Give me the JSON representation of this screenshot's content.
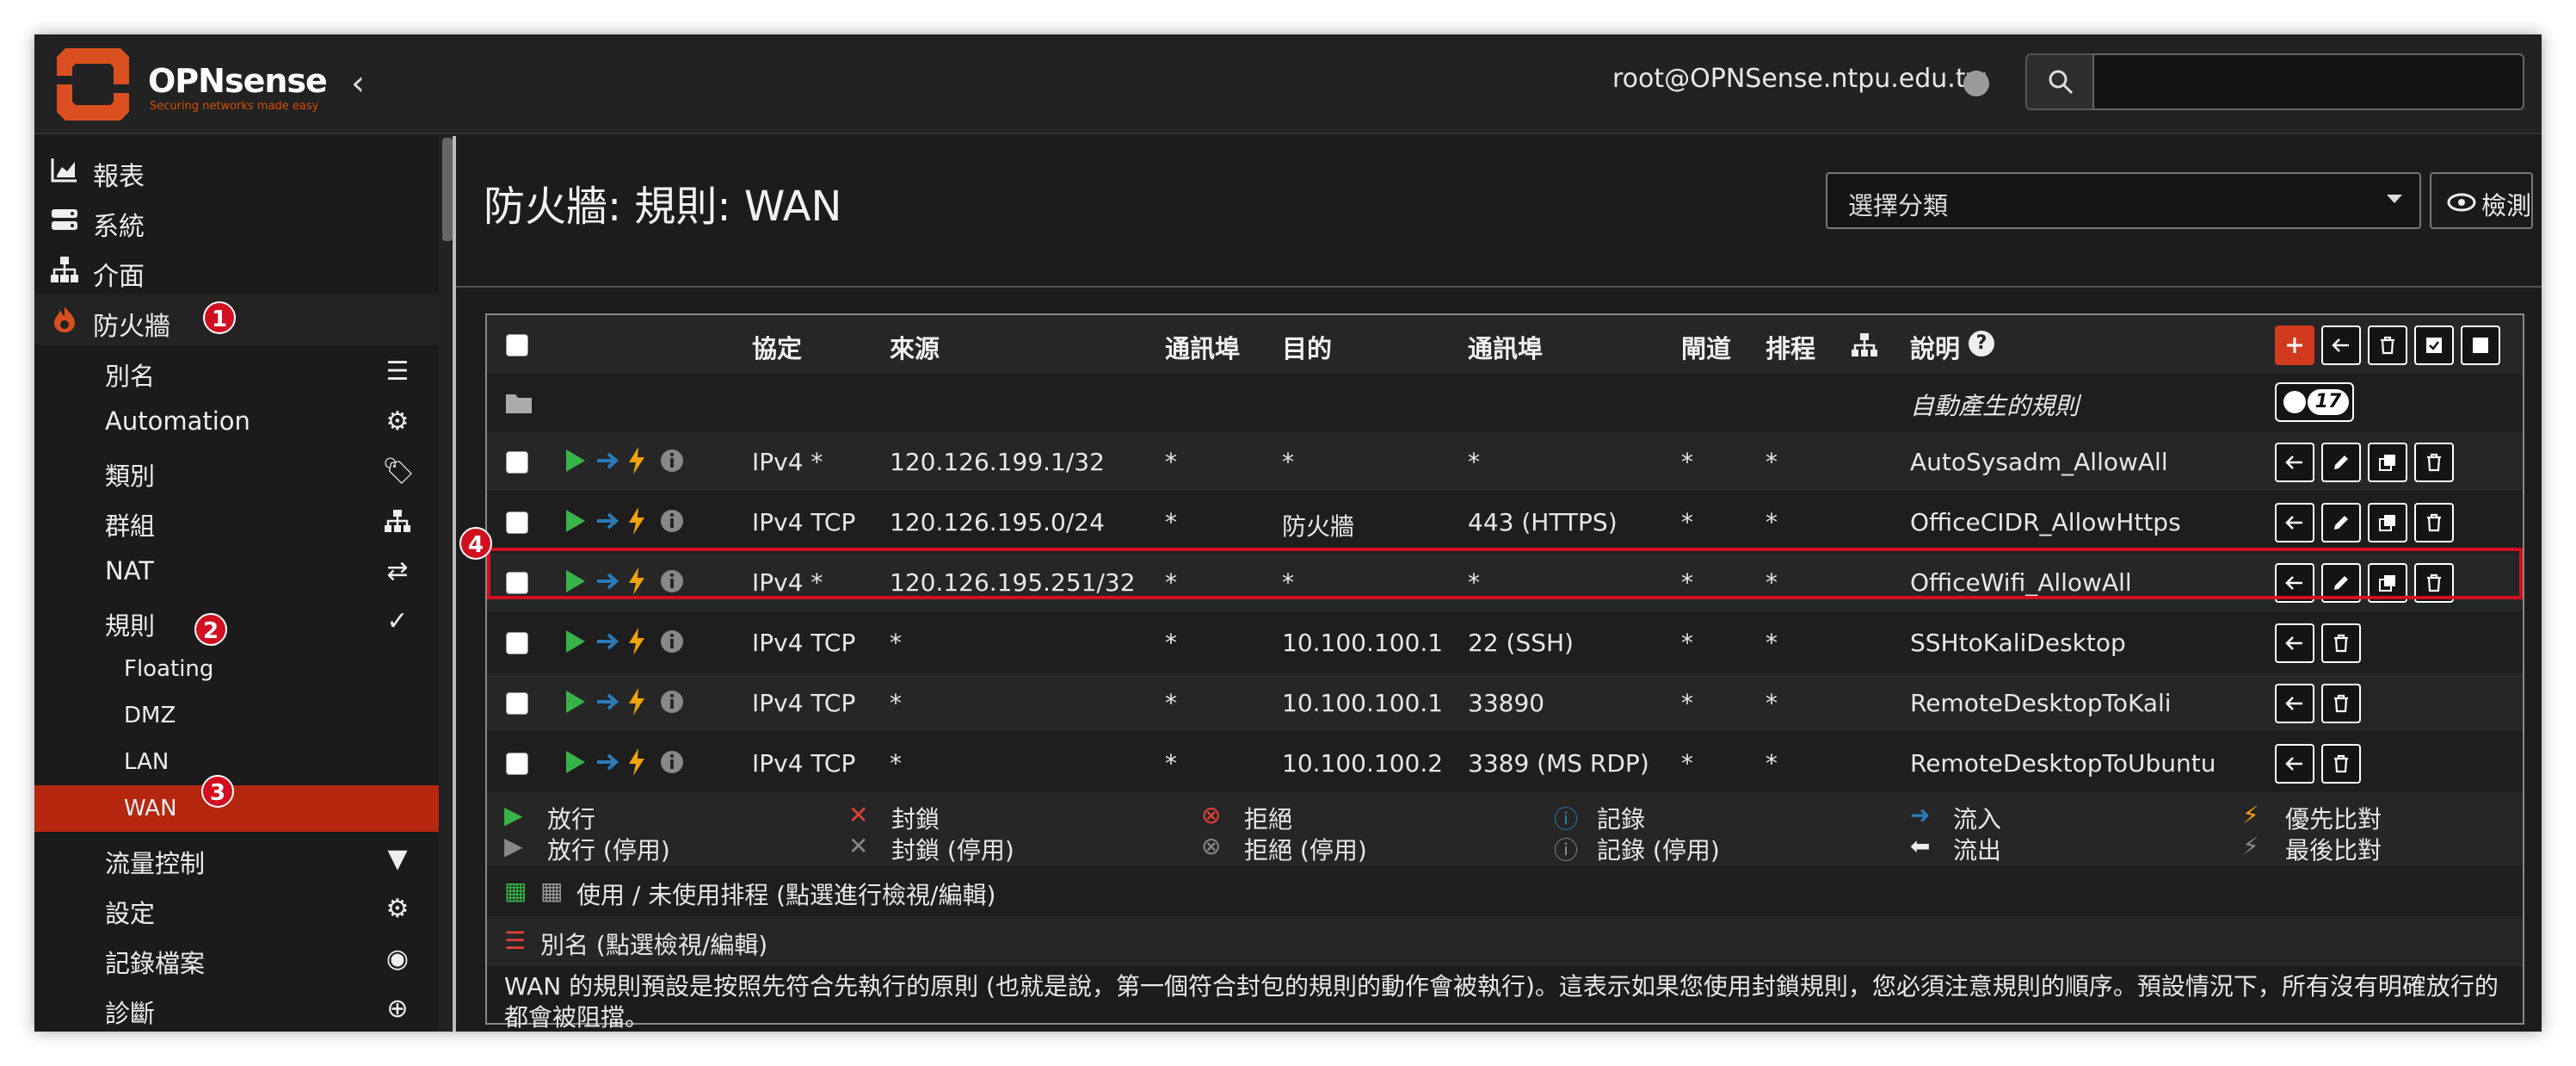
{
  "header": {
    "brand": "OPNsense",
    "tagline": "Securing networks made easy",
    "user": "root@OPNSense.ntpu.edu.tw",
    "search_value": ""
  },
  "sidebar": {
    "top_items": [
      "報表",
      "系統",
      "介面",
      "防火牆"
    ],
    "firewall_items": [
      "別名",
      "Automation",
      "類別",
      "群組",
      "NAT",
      "規則"
    ],
    "rule_items": [
      "Floating",
      "DMZ",
      "LAN",
      "WAN"
    ],
    "bottom_items": [
      "流量控制",
      "設定",
      "記錄檔案",
      "診斷"
    ]
  },
  "annotations": [
    "1",
    "2",
    "3",
    "4"
  ],
  "page": {
    "title": "防火牆: 規則: WAN",
    "category_placeholder": "選擇分類",
    "inspect_label": "檢測"
  },
  "table": {
    "headers": [
      "協定",
      "來源",
      "通訊埠",
      "目的",
      "通訊埠",
      "閘道",
      "排程",
      "說明"
    ],
    "auto_rules_label": "自動產生的規則",
    "auto_rules_count": "17",
    "rows": [
      {
        "proto": "IPv4 *",
        "src": "120.126.199.1/32",
        "sport": "*",
        "dst": "*",
        "dport": "*",
        "gw": "*",
        "sched": "*",
        "desc": "AutoSysadm_AllowAll",
        "edit": true
      },
      {
        "proto": "IPv4 TCP",
        "src": "120.126.195.0/24",
        "sport": "*",
        "dst": "防火牆",
        "dport": "443 (HTTPS)",
        "gw": "*",
        "sched": "*",
        "desc": "OfficeCIDR_AllowHttps",
        "edit": true
      },
      {
        "proto": "IPv4 *",
        "src": "120.126.195.251/32",
        "sport": "*",
        "dst": "*",
        "dport": "*",
        "gw": "*",
        "sched": "*",
        "desc": "OfficeWifi_AllowAll",
        "edit": true
      },
      {
        "proto": "IPv4 TCP",
        "src": "*",
        "sport": "*",
        "dst": "10.100.100.1",
        "dport": "22 (SSH)",
        "gw": "*",
        "sched": "*",
        "desc": "SSHtoKaliDesktop",
        "edit": false
      },
      {
        "proto": "IPv4 TCP",
        "src": "*",
        "sport": "*",
        "dst": "10.100.100.1",
        "dport": "33890",
        "gw": "*",
        "sched": "*",
        "desc": "RemoteDesktopToKali",
        "edit": false
      },
      {
        "proto": "IPv4 TCP",
        "src": "*",
        "sport": "*",
        "dst": "10.100.100.2",
        "dport": "3389 (MS RDP)",
        "gw": "*",
        "sched": "*",
        "desc": "RemoteDesktopToUbuntu",
        "edit": false
      }
    ]
  },
  "legend": {
    "pass": "放行",
    "pass_disabled": "放行 (停用)",
    "block": "封鎖",
    "block_disabled": "封鎖 (停用)",
    "reject": "拒絕",
    "reject_disabled": "拒絕 (停用)",
    "log": "記錄",
    "log_disabled": "記錄 (停用)",
    "in": "流入",
    "out": "流出",
    "first": "優先比對",
    "last": "最後比對"
  },
  "schedule_note": "使用 / 未使用排程 (點選進行檢視/編輯)",
  "alias_note": "別名 (點選檢視/編輯)",
  "footer_note": "WAN 的規則預設是按照先符合先執行的原則 (也就是說，第一個符合封包的規則的動作會被執行)。這表示如果您使用封鎖規則，您必須注意規則的順序。預設情況下，所有沒有明確放行的都會被阻擋。",
  "colors": {
    "accent": "#d13a1f",
    "selected": "#b5270f",
    "highlight": "#d01020",
    "pass": "#37b34a",
    "arrow": "#2b7bb9",
    "bolt": "#f0a30a"
  }
}
